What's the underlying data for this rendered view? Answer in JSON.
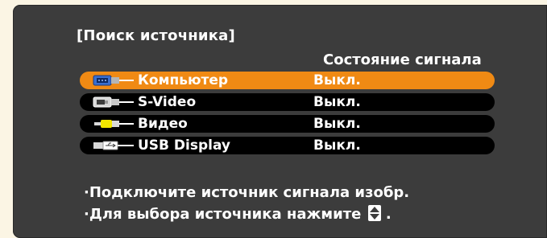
{
  "panel": {
    "title": "[Поиск источника]",
    "status_header": "Состояние сигнала"
  },
  "sources": [
    {
      "label": "Компьютер",
      "status": "Выкл.",
      "icon": "computer-port-icon",
      "selected": true
    },
    {
      "label": "S-Video",
      "status": "Выкл.",
      "icon": "s-video-port-icon",
      "selected": false
    },
    {
      "label": "Видео",
      "status": "Выкл.",
      "icon": "video-rca-icon",
      "selected": false
    },
    {
      "label": "USB Display",
      "status": "Выкл.",
      "icon": "usb-port-icon",
      "selected": false
    }
  ],
  "notes": {
    "line1": "·Подключите источник сигнала изобр.",
    "line2_prefix": "·Для выбора источника нажмите",
    "line2_icon": "up-down-arrow-icon",
    "line2_suffix": "."
  },
  "colors": {
    "background": "#3c3c3c",
    "selected_row": "#f08a14",
    "row": "#000000",
    "text": "#ffffff",
    "outer": "#fbf5e4"
  }
}
